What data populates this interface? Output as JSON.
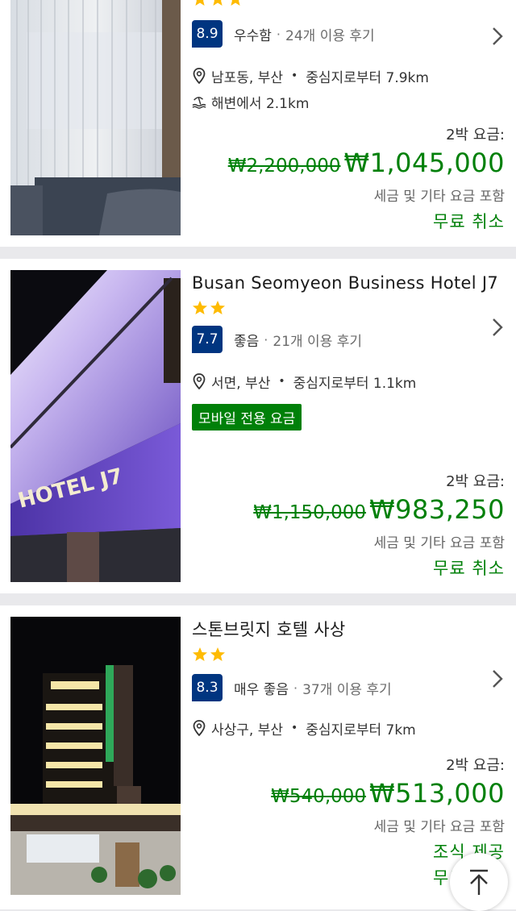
{
  "colors": {
    "brand_blue": "#003580",
    "price_green": "#008009",
    "star_yellow": "#febb02"
  },
  "hotels": [
    {
      "stars": 3,
      "rating_score": "8.9",
      "rating_word": "우수함",
      "review_count": "24개 이용 후기",
      "location": "남포동, 부산",
      "distance": "중심지로부터 7.9km",
      "beach": "해변에서 2.1km",
      "nights_label": "2박 요금:",
      "old_price": "₩2,200,000",
      "new_price": "₩1,045,000",
      "tax_note": "세금 및 기타 요금 포함",
      "perks": [
        "무료 취소"
      ]
    },
    {
      "name": "Busan Seomyeon Business Hotel J7",
      "stars": 2,
      "rating_score": "7.7",
      "rating_word": "좋음",
      "review_count": "21개 이용 후기",
      "location": "서면, 부산",
      "distance": "중심지로부터 1.1km",
      "badge": "모바일 전용 요금",
      "photo_sign": "HOTEL J7",
      "nights_label": "2박 요금:",
      "old_price": "₩1,150,000",
      "new_price": "₩983,250",
      "tax_note": "세금 및 기타 요금 포함",
      "perks": [
        "무료 취소"
      ]
    },
    {
      "name": "스톤브릿지 호텔 사상",
      "stars": 2,
      "rating_score": "8.3",
      "rating_word": "매우 좋음",
      "review_count": "37개 이용 후기",
      "location": "사상구, 부산",
      "distance": "중심지로부터 7km",
      "nights_label": "2박 요금:",
      "old_price": "₩540,000",
      "new_price": "₩513,000",
      "tax_note": "세금 및 기타 요금 포함",
      "perks": [
        "조식 제공",
        "무료 취소"
      ]
    }
  ],
  "icons": {
    "location": "map-pin-icon",
    "beach": "beach-icon",
    "chevron": "chevron-right-icon",
    "star": "star-icon",
    "back_to_top": "arrow-up-icon"
  }
}
